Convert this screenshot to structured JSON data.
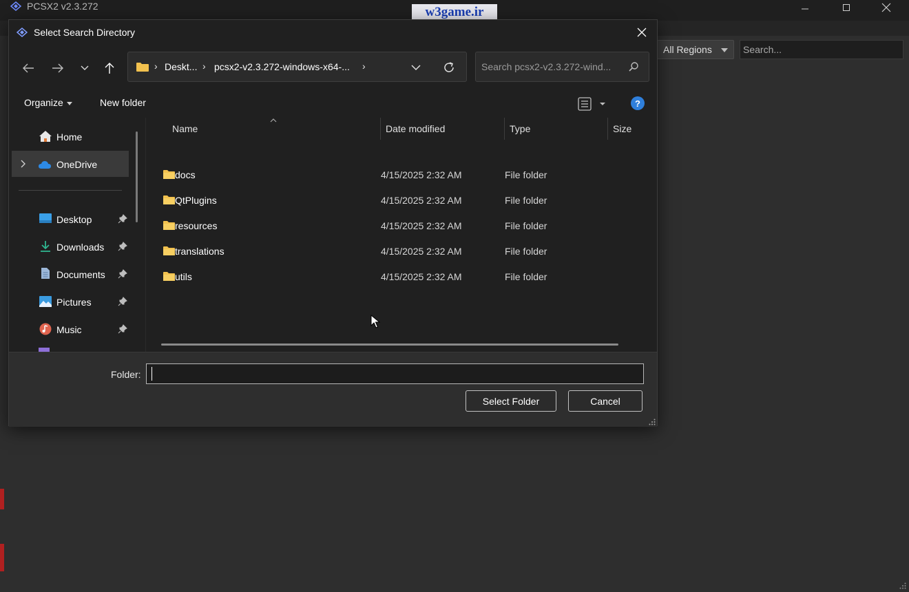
{
  "app": {
    "title": "PCSX2 v2.3.272",
    "watermark": "w3game.ir",
    "region_filter": "All Regions",
    "search_placeholder": "Search..."
  },
  "dialog": {
    "title": "Select Search Directory",
    "address": {
      "segments": [
        "Deskt...",
        "pcsx2-v2.3.272-windows-x64-..."
      ]
    },
    "search_placeholder": "Search pcsx2-v2.3.272-wind...",
    "commands": {
      "organize": "Organize",
      "new_folder": "New folder"
    },
    "nav": {
      "items": [
        {
          "label": "Home",
          "icon": "home-icon"
        },
        {
          "label": "OneDrive",
          "icon": "cloud-icon"
        },
        {
          "label": "Desktop",
          "icon": "desktop-icon"
        },
        {
          "label": "Downloads",
          "icon": "download-icon"
        },
        {
          "label": "Documents",
          "icon": "document-icon"
        },
        {
          "label": "Pictures",
          "icon": "picture-icon"
        },
        {
          "label": "Music",
          "icon": "music-icon"
        }
      ]
    },
    "columns": [
      "Name",
      "Date modified",
      "Type",
      "Size"
    ],
    "files": [
      {
        "name": "docs",
        "date": "4/15/2025 2:32 AM",
        "type": "File folder"
      },
      {
        "name": "QtPlugins",
        "date": "4/15/2025 2:32 AM",
        "type": "File folder"
      },
      {
        "name": "resources",
        "date": "4/15/2025 2:32 AM",
        "type": "File folder"
      },
      {
        "name": "translations",
        "date": "4/15/2025 2:32 AM",
        "type": "File folder"
      },
      {
        "name": "utils",
        "date": "4/15/2025 2:32 AM",
        "type": "File folder"
      }
    ],
    "folder_label": "Folder:",
    "folder_value": "",
    "select_button": "Select Folder",
    "cancel_button": "Cancel"
  },
  "colors": {
    "folder": "#f2c14e",
    "accent": "#2f7fdb"
  }
}
